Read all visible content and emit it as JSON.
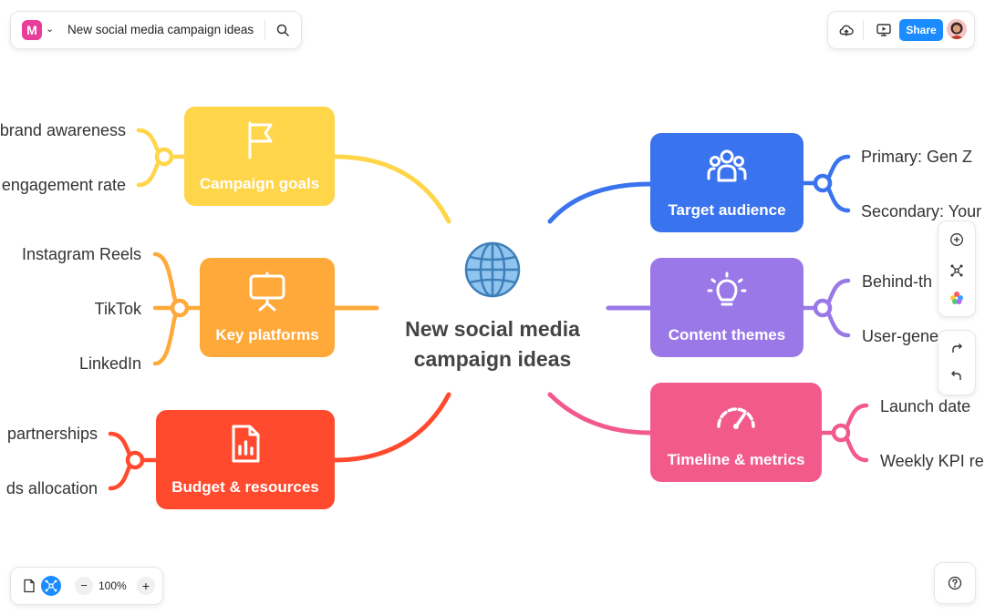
{
  "doc": {
    "title": "New social media campaign ideas"
  },
  "toolbar": {
    "share_label": "Share"
  },
  "zoom": {
    "level": "100%",
    "minus": "−",
    "plus": "+"
  },
  "mindmap": {
    "center": {
      "line1": "New social media",
      "line2": "campaign ideas",
      "icon": "globe-icon"
    },
    "branches": [
      {
        "label": "Campaign goals",
        "color": "#ffd54a",
        "icon": "flag-icon",
        "children": [
          "brand awareness",
          "engagement rate"
        ]
      },
      {
        "label": "Key platforms",
        "color": "#ffa93a",
        "icon": "presentation-icon",
        "children": [
          "Instagram Reels",
          "TikTok",
          "LinkedIn"
        ]
      },
      {
        "label": "Budget & resources",
        "color": "#ff4a2e",
        "icon": "report-icon",
        "children": [
          "partnerships",
          "ds allocation"
        ]
      },
      {
        "label": "Target audience",
        "color": "#3a73ee",
        "icon": "people-icon",
        "children": [
          "Primary: Gen Z",
          "Secondary: Your"
        ]
      },
      {
        "label": "Content themes",
        "color": "#9a78e8",
        "icon": "lightbulb-icon",
        "children": [
          "Behind-th",
          "User-gene"
        ]
      },
      {
        "label": "Timeline & metrics",
        "color": "#f25a8c",
        "icon": "speedometer-icon",
        "children": [
          "Launch date",
          "Weekly KPI re"
        ]
      }
    ]
  }
}
